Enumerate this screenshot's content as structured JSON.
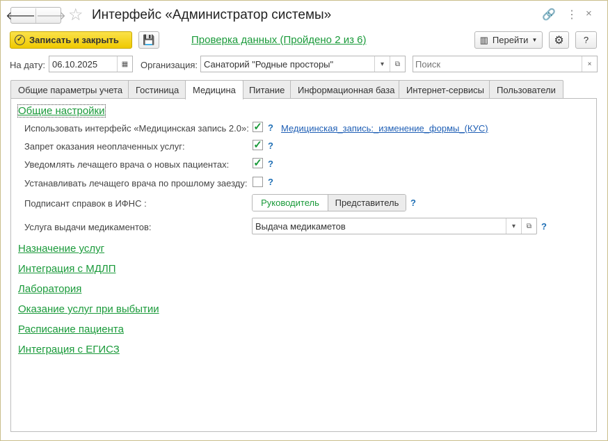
{
  "window": {
    "title": "Интерфейс «Администратор системы»"
  },
  "toolbar": {
    "save_close": "Записать и закрыть",
    "check_link": "Проверка данных (Пройдено 2 из 6)",
    "goto": "Перейти",
    "help": "?"
  },
  "filters": {
    "date_label": "На дату:",
    "date_value": "06.10.2025",
    "org_label": "Организация:",
    "org_value": "Санаторий \"Родные просторы\"",
    "search_placeholder": "Поиск"
  },
  "tabs": [
    "Общие параметры учета",
    "Гостиница",
    "Медицина",
    "Питание",
    "Информационная база",
    "Интернет-сервисы",
    "Пользователи"
  ],
  "medicine": {
    "general_title": "Общие настройки",
    "settings": [
      {
        "label": "Использовать интерфейс «Медицинская запись 2.0»:",
        "checked": true
      },
      {
        "label": "Запрет оказания неоплаченных услуг:",
        "checked": true
      },
      {
        "label": "Уведомлять лечащего врача о новых пациентах:",
        "checked": true
      },
      {
        "label": "Устанавливать лечащего врача по прошлому заезду:",
        "checked": false
      }
    ],
    "form_link": "Медицинская_запись:_изменение_формы_(КУС)",
    "signer_label": "Подписант справок в ИФНС :",
    "signer_options": [
      "Руководитель",
      "Представитель"
    ],
    "signer_selected": "Руководитель",
    "drug_label": "Услуга выдачи медикаментов:",
    "drug_value": "Выдача медикаметов",
    "help": "?",
    "sections": [
      "Назначение услуг",
      "Интеграция с МДЛП",
      "Лаборатория",
      "Оказание услуг при выбытии",
      "Расписание пациента",
      "Интеграция с ЕГИСЗ"
    ]
  }
}
